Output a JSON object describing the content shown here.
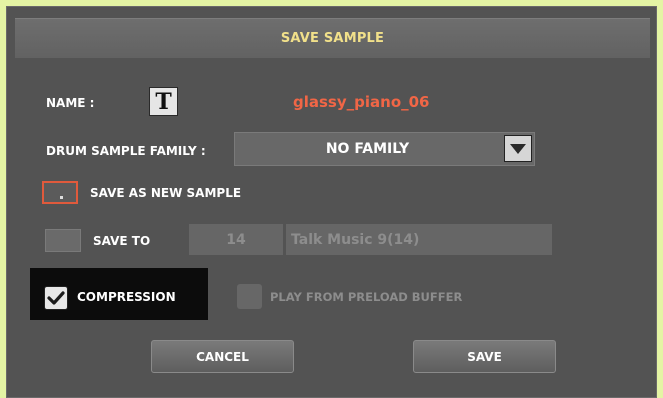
{
  "dialog": {
    "title": "SAVE SAMPLE"
  },
  "name_row": {
    "label": "NAME :",
    "text_edit_icon": "T",
    "value": "glassy_piano_06"
  },
  "family_row": {
    "label": "DRUM SAMPLE FAMILY :",
    "selected": "NO FAMILY"
  },
  "save_as_new": {
    "label": "SAVE AS NEW SAMPLE",
    "checked": false
  },
  "save_to": {
    "label": "SAVE TO",
    "number": "14",
    "destination": "Talk Music 9(14)",
    "enabled": false
  },
  "compression": {
    "label": "COMPRESSION",
    "checked": true
  },
  "preload": {
    "label": "PLAY FROM PRELOAD BUFFER",
    "checked": false,
    "enabled": false
  },
  "buttons": {
    "cancel": "CANCEL",
    "save": "SAVE"
  },
  "colors": {
    "accent_title": "#f1e08a",
    "name_value": "#f16646",
    "background": "#535353"
  }
}
